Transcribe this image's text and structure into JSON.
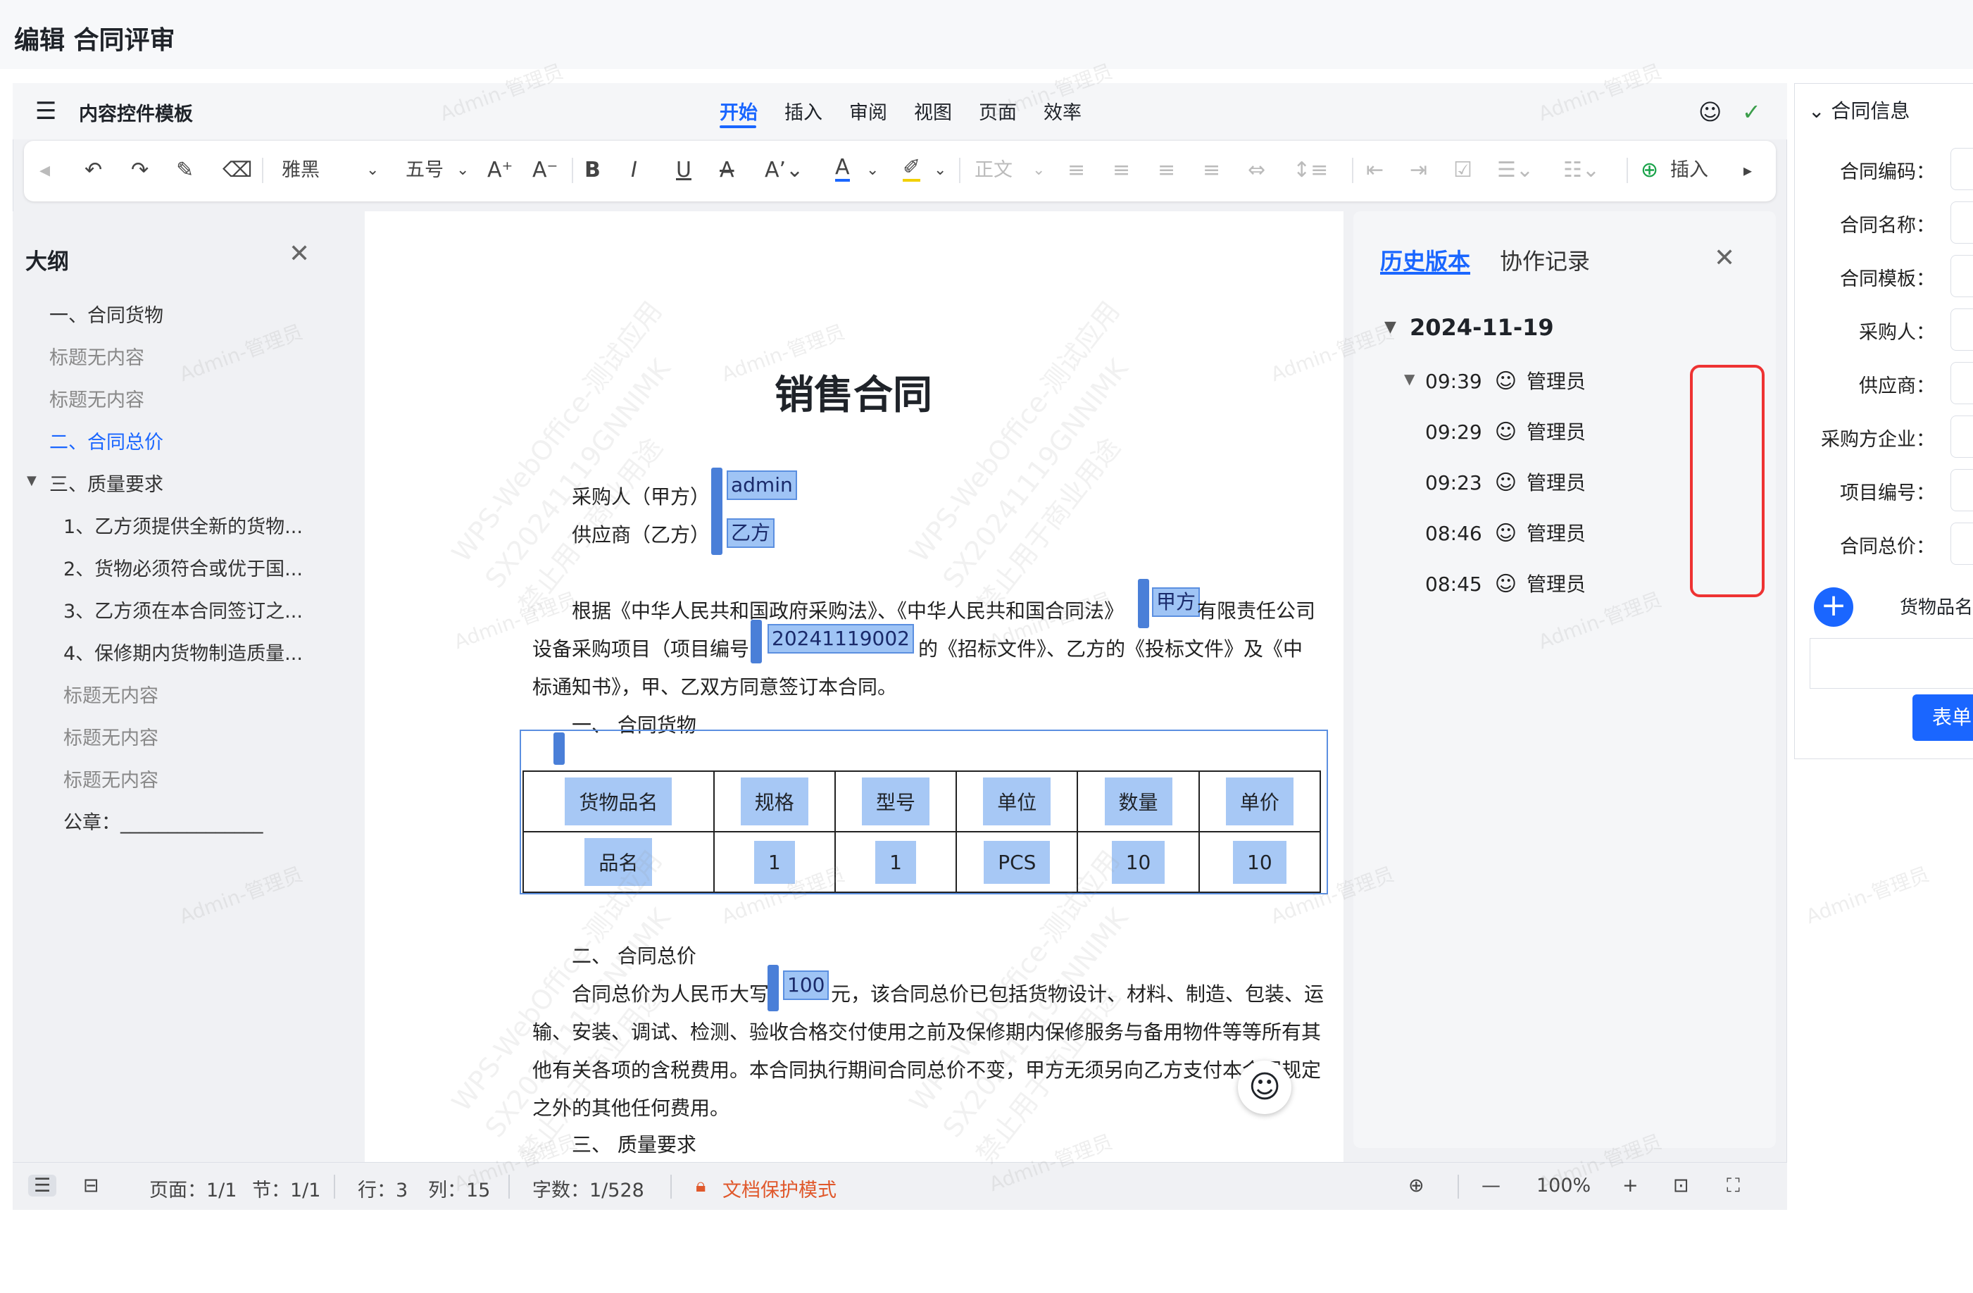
{
  "page": {
    "title": "编辑 合同评审"
  },
  "menubar": {
    "template_title": "内容控件模板",
    "tabs": [
      "开始",
      "插入",
      "审阅",
      "视图",
      "页面",
      "效率"
    ]
  },
  "toolbar": {
    "font": "雅黑",
    "size": "五号",
    "style": "正文",
    "insert": "插入"
  },
  "outline": {
    "title": "大纲",
    "items": [
      {
        "label": "一、合同货物",
        "state": "normal"
      },
      {
        "label": "标题无内容",
        "state": "grey"
      },
      {
        "label": "标题无内容",
        "state": "grey"
      },
      {
        "label": "二、合同总价",
        "state": "active"
      },
      {
        "label": "三、质量要求",
        "state": "normal"
      },
      {
        "label": "1、乙方须提供全新的货物...",
        "state": "normal"
      },
      {
        "label": "2、货物必须符合或优于国...",
        "state": "normal"
      },
      {
        "label": "3、乙方须在本合同签订之...",
        "state": "normal"
      },
      {
        "label": "4、保修期内货物制造质量...",
        "state": "normal"
      },
      {
        "label": "标题无内容",
        "state": "grey"
      },
      {
        "label": "标题无内容",
        "state": "grey"
      },
      {
        "label": "标题无内容",
        "state": "grey"
      },
      {
        "label": "公章：_______________",
        "state": "normal"
      }
    ]
  },
  "document": {
    "title": "销售合同",
    "buyer_label": "采购人（甲方）",
    "buyer_value": "admin",
    "supplier_label": "供应商（乙方）",
    "supplier_value": "乙方",
    "para1_a": "根据《中华人民共和国政府采购法》、《中华人民共和国合同法》",
    "para1_field": "甲方",
    "para1_b": "有限责任公司",
    "para1_c": "设备采购项目（项目编号",
    "project_no": "20241119002",
    "para1_d": "的《招标文件》、乙方的《投标文件》及《中",
    "para1_e": "标通知书》，甲、乙双方同意签订本合同。",
    "sec1": "一、 合同货物",
    "table": {
      "headers": [
        "货物品名",
        "规格",
        "型号",
        "单位",
        "数量",
        "单价"
      ],
      "rows": [
        [
          "品名",
          "1",
          "1",
          "PCS",
          "10",
          "10"
        ]
      ]
    },
    "sec2": "二、 合同总价",
    "para2_a": "合同总价为人民币大写",
    "total": "100",
    "para2_b": "元，该合同总价已包括货物设计、材料、制造、包装、运",
    "para2_c": "输、安装、调试、检测、验收合格交付使用之前及保修期内保修服务与备用物件等等所有其",
    "para2_d": "他有关各项的含税费用。本合同执行期间合同总价不变，甲方无须另向乙方支付本合同规定",
    "para2_e": "之外的其他任何费用。",
    "sec3": "三、 质量要求"
  },
  "history": {
    "tab_history": "历史版本",
    "tab_collab": "协作记录",
    "date": "2024-11-19",
    "entries": [
      {
        "time": "09:39",
        "user": "管理员"
      },
      {
        "time": "09:29",
        "user": "管理员"
      },
      {
        "time": "09:23",
        "user": "管理员"
      },
      {
        "time": "08:46",
        "user": "管理员"
      },
      {
        "time": "08:45",
        "user": "管理员"
      }
    ]
  },
  "contract_info": {
    "title": "合同信息",
    "fields": [
      "合同编码：",
      "合同名称：",
      "合同模板：",
      "采购人：",
      "供应商：",
      "采购方企业：",
      "项目编号：",
      "合同总价："
    ],
    "goods_col": "货物品名",
    "form_button": "表单"
  },
  "statusbar": {
    "page": "页面：1/1",
    "section": "节：1/1",
    "row": "行：3",
    "col": "列：15",
    "words": "字数：1/528",
    "protect": "文档保护模式",
    "zoom": "100%"
  },
  "watermark": {
    "user": "Admin-管理员",
    "line1": "WPS-WebOffice-测试应用",
    "line2": "SX20241119GNNIMK",
    "line3": "禁止用于商业用途"
  }
}
